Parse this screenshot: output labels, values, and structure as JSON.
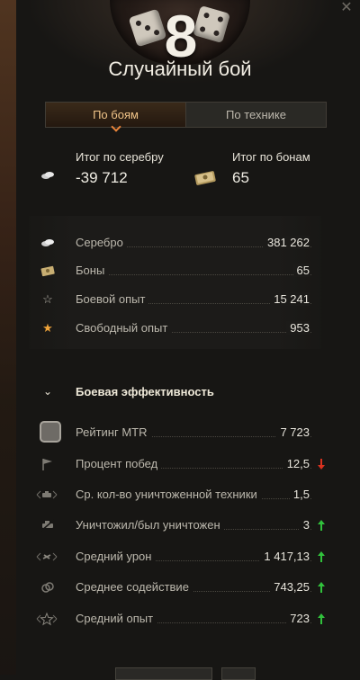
{
  "header": {
    "level": "8",
    "title": "Случайный бой"
  },
  "tabs": [
    {
      "label": "По боям",
      "active": true
    },
    {
      "label": "По технике",
      "active": false
    }
  ],
  "summary": {
    "silver_label": "Итог по серебру",
    "silver_value": "-39 712",
    "bonds_label": "Итог по бонам",
    "bonds_value": "65"
  },
  "resources": [
    {
      "icon": "silver-icon",
      "label": "Серебро",
      "value": "381 262"
    },
    {
      "icon": "bond-icon",
      "label": "Боны",
      "value": "65"
    },
    {
      "icon": "battle-xp-star-icon",
      "label": "Боевой опыт",
      "value": "15 241"
    },
    {
      "icon": "free-xp-star-icon",
      "label": "Свободный опыт",
      "value": "953"
    }
  ],
  "efficiency": {
    "title": "Боевая эффективность",
    "items": [
      {
        "icon": "mtr-rating-icon",
        "label": "Рейтинг MTR",
        "value": "7 723",
        "trend": "none"
      },
      {
        "icon": "flag-icon",
        "label": "Процент побед",
        "value": "12,5",
        "trend": "down"
      },
      {
        "icon": "destroyed-vehicle-icon",
        "label": "Ср. кол-во уничтоженной техники",
        "value": "1,5",
        "trend": "none"
      },
      {
        "icon": "kill-death-icon",
        "label": "Уничтожил/был уничтожен",
        "value": "3",
        "trend": "up"
      },
      {
        "icon": "damage-icon",
        "label": "Средний урон",
        "value": "1 417,13",
        "trend": "up"
      },
      {
        "icon": "assist-icon",
        "label": "Среднее содействие",
        "value": "743,25",
        "trend": "up"
      },
      {
        "icon": "average-xp-icon",
        "label": "Средний опыт",
        "value": "723",
        "trend": "up"
      }
    ]
  },
  "colors": {
    "accent": "#e9843a",
    "trend_up": "#31c23c",
    "trend_down": "#d9311f"
  }
}
